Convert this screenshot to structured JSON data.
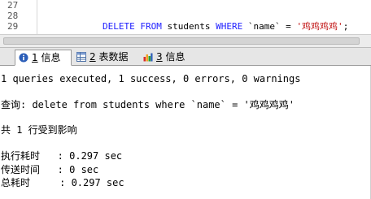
{
  "editor": {
    "lines": [
      {
        "number": "27",
        "code": []
      },
      {
        "number": "28",
        "code": [
          {
            "cls": "kw",
            "text": "DELETE FROM"
          },
          {
            "cls": "plain",
            "text": " students "
          },
          {
            "cls": "kw",
            "text": "WHERE"
          },
          {
            "cls": "plain",
            "text": " `name` = "
          },
          {
            "cls": "str",
            "text": "'鸡鸡鸡鸡'"
          },
          {
            "cls": "plain",
            "text": ";"
          }
        ]
      },
      {
        "number": "29",
        "code": []
      }
    ]
  },
  "tabs": [
    {
      "icon": "info-icon",
      "number": "1",
      "label": "信息",
      "active": true
    },
    {
      "icon": "table-icon",
      "number": "2",
      "label": "表数据",
      "active": false
    },
    {
      "icon": "chart-icon",
      "number": "3",
      "label": "信息",
      "active": false
    }
  ],
  "output": {
    "summary": "1 queries executed, 1 success, 0 errors, 0 warnings",
    "query_line": "查询: delete from students where `name` = '鸡鸡鸡鸡'",
    "affected_line": "共 1 行受到影响",
    "exec_time": "执行耗时   : 0.297 sec",
    "transfer_time": "传送时间   : 0 sec",
    "total_time": "总耗时     : 0.297 sec"
  },
  "colors": {
    "keyword": "#2020ff",
    "string": "#c01010",
    "tab_bar": "#e6e6e6"
  }
}
